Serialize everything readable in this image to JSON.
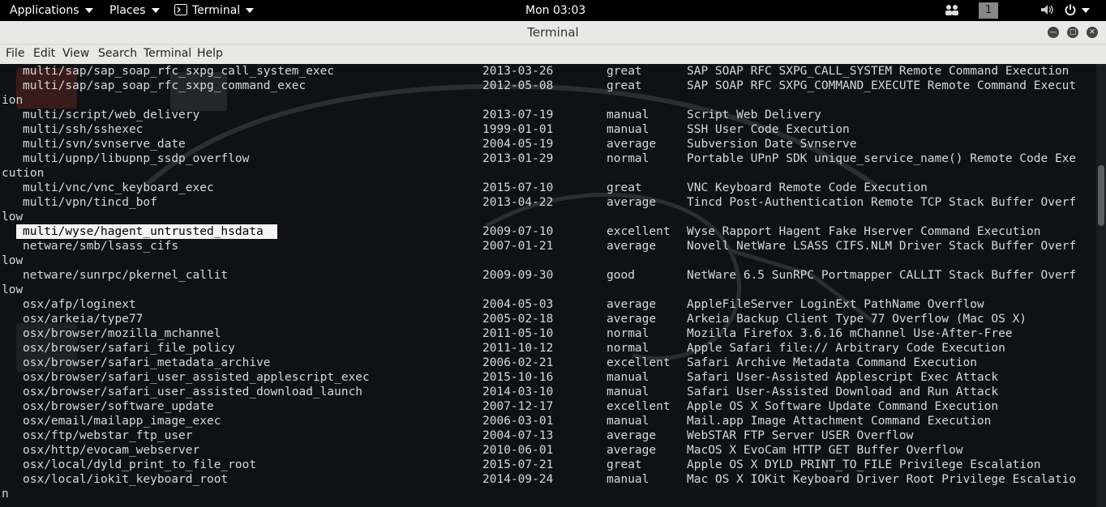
{
  "topbar": {
    "applications": "Applications",
    "places": "Places",
    "terminal": "Terminal",
    "clock": "Mon 03:03",
    "workspace": "1"
  },
  "window": {
    "title": "Terminal"
  },
  "menu": {
    "file": "File",
    "edit": "Edit",
    "view": "View",
    "search": "Search",
    "terminal": "Terminal",
    "help": "Help"
  },
  "terminal": {
    "lines": [
      {
        "name": "multi/sap/sap_soap_rfc_sxpg_call_system_exec",
        "date": "2013-03-26",
        "rank": "great",
        "desc": "SAP SOAP RFC SXPG_CALL_SYSTEM Remote Command Execution"
      },
      {
        "name": "multi/sap/sap_soap_rfc_sxpg_command_exec",
        "date": "2012-05-08",
        "rank": "great",
        "desc": "SAP SOAP RFC SXPG_COMMAND_EXECUTE Remote Command Execut"
      },
      {
        "wrap": "ion"
      },
      {
        "name": "multi/script/web_delivery",
        "date": "2013-07-19",
        "rank": "manual",
        "desc": "Script Web Delivery"
      },
      {
        "name": "multi/ssh/sshexec",
        "date": "1999-01-01",
        "rank": "manual",
        "desc": "SSH User Code Execution"
      },
      {
        "name": "multi/svn/svnserve_date",
        "date": "2004-05-19",
        "rank": "average",
        "desc": "Subversion Date Svnserve"
      },
      {
        "name": "multi/upnp/libupnp_ssdp_overflow",
        "date": "2013-01-29",
        "rank": "normal",
        "desc": "Portable UPnP SDK unique_service_name() Remote Code Exe"
      },
      {
        "wrap": "cution"
      },
      {
        "name": "multi/vnc/vnc_keyboard_exec",
        "date": "2015-07-10",
        "rank": "great",
        "desc": "VNC Keyboard Remote Code Execution"
      },
      {
        "name": "multi/vpn/tincd_bof",
        "date": "2013-04-22",
        "rank": "average",
        "desc": "Tincd Post-Authentication Remote TCP Stack Buffer Overf"
      },
      {
        "wrap": "low"
      },
      {
        "name": "multi/wyse/hagent_untrusted_hsdata",
        "date": "2009-07-10",
        "rank": "excellent",
        "desc": "Wyse Rapport Hagent Fake Hserver Command Execution",
        "selected": true
      },
      {
        "name": "netware/smb/lsass_cifs",
        "date": "2007-01-21",
        "rank": "average",
        "desc": "Novell NetWare LSASS CIFS.NLM Driver Stack Buffer Overf"
      },
      {
        "wrap": "low"
      },
      {
        "name": "netware/sunrpc/pkernel_callit",
        "date": "2009-09-30",
        "rank": "good",
        "desc": "NetWare 6.5 SunRPC Portmapper CALLIT Stack Buffer Overf"
      },
      {
        "wrap": "low"
      },
      {
        "name": "osx/afp/loginext",
        "date": "2004-05-03",
        "rank": "average",
        "desc": "AppleFileServer LoginExt PathName Overflow"
      },
      {
        "name": "osx/arkeia/type77",
        "date": "2005-02-18",
        "rank": "average",
        "desc": "Arkeia Backup Client Type 77 Overflow (Mac OS X)"
      },
      {
        "name": "osx/browser/mozilla_mchannel",
        "date": "2011-05-10",
        "rank": "normal",
        "desc": "Mozilla Firefox 3.6.16 mChannel Use-After-Free"
      },
      {
        "name": "osx/browser/safari_file_policy",
        "date": "2011-10-12",
        "rank": "normal",
        "desc": "Apple Safari file:// Arbitrary Code Execution"
      },
      {
        "name": "osx/browser/safari_metadata_archive",
        "date": "2006-02-21",
        "rank": "excellent",
        "desc": "Safari Archive Metadata Command Execution"
      },
      {
        "name": "osx/browser/safari_user_assisted_applescript_exec",
        "date": "2015-10-16",
        "rank": "manual",
        "desc": "Safari User-Assisted Applescript Exec Attack"
      },
      {
        "name": "osx/browser/safari_user_assisted_download_launch",
        "date": "2014-03-10",
        "rank": "manual",
        "desc": "Safari User-Assisted Download and Run Attack"
      },
      {
        "name": "osx/browser/software_update",
        "date": "2007-12-17",
        "rank": "excellent",
        "desc": "Apple OS X Software Update Command Execution"
      },
      {
        "name": "osx/email/mailapp_image_exec",
        "date": "2006-03-01",
        "rank": "manual",
        "desc": "Mail.app Image Attachment Command Execution"
      },
      {
        "name": "osx/ftp/webstar_ftp_user",
        "date": "2004-07-13",
        "rank": "average",
        "desc": "WebSTAR FTP Server USER Overflow"
      },
      {
        "name": "osx/http/evocam_webserver",
        "date": "2010-06-01",
        "rank": "average",
        "desc": "MacOS X EvoCam HTTP GET Buffer Overflow"
      },
      {
        "name": "osx/local/dyld_print_to_file_root",
        "date": "2015-07-21",
        "rank": "great",
        "desc": "Apple OS X DYLD_PRINT_TO_FILE Privilege Escalation"
      },
      {
        "name": "osx/local/iokit_keyboard_root",
        "date": "2014-09-24",
        "rank": "manual",
        "desc": "Mac OS X IOKit Keyboard Driver Root Privilege Escalatio"
      },
      {
        "wrap": "n"
      }
    ]
  },
  "colors": {
    "terminal_bg": "#0f1115",
    "text": "#d8d8d8",
    "chrome": "#e8e8e7",
    "selection": "#f4f4f4"
  },
  "icons": {
    "terminal": "terminal-icon",
    "people": "people-icon",
    "volume": "volume-icon",
    "power": "power-icon"
  }
}
